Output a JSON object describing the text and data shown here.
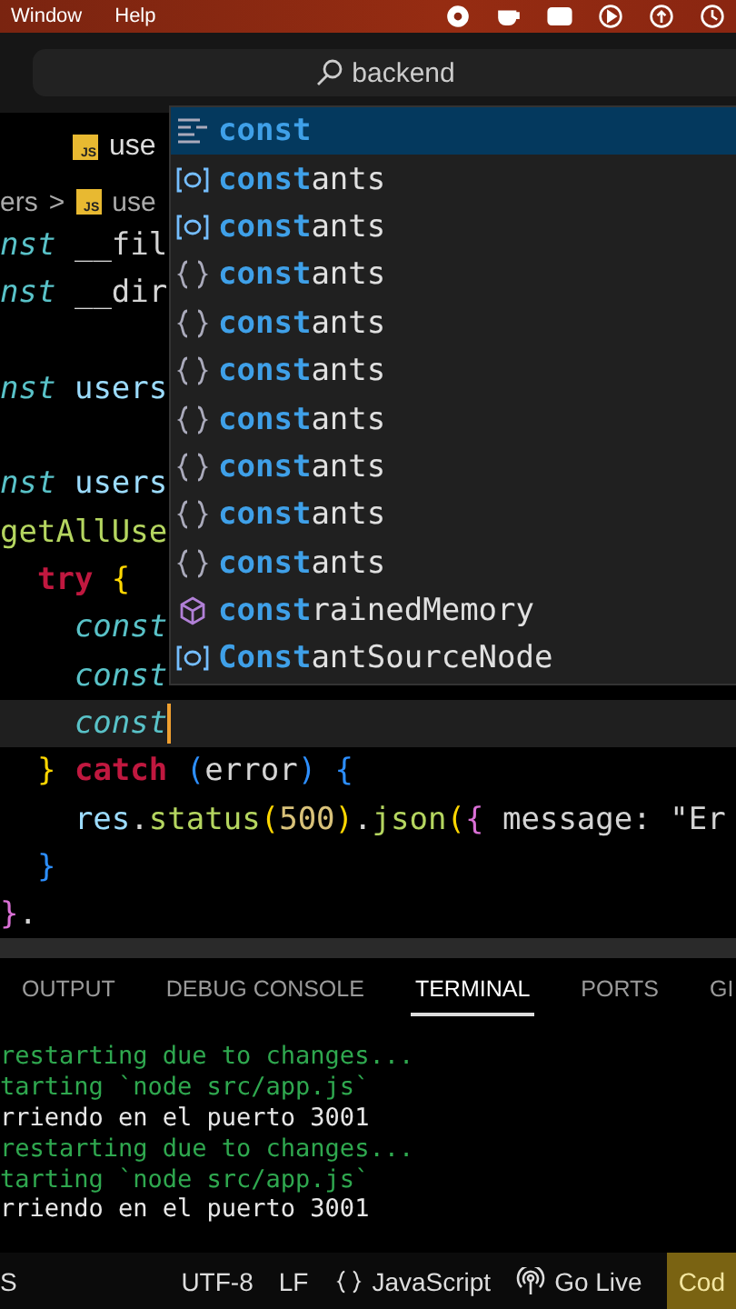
{
  "menubar": {
    "items": [
      "Window",
      "Help"
    ]
  },
  "command_center": {
    "text": "backend"
  },
  "editor_tab": {
    "badge": "JS",
    "label": "use",
    "selected": true
  },
  "breadcrumb": [
    {
      "kind": "text",
      "text": "ers"
    },
    {
      "kind": "separator",
      "text": ">"
    },
    {
      "kind": "file",
      "badge": "JS",
      "text": "use"
    }
  ],
  "code_lines": [
    {
      "current": false,
      "segments": [
        {
          "kind": "keyword",
          "text": "nst"
        },
        {
          "kind": "plain",
          "text": " __fil"
        }
      ]
    },
    {
      "current": false,
      "segments": [
        {
          "kind": "keyword",
          "text": "nst"
        },
        {
          "kind": "plain",
          "text": " __dir"
        }
      ]
    },
    {
      "current": false
    },
    {
      "current": false,
      "segments": [
        {
          "kind": "keyword",
          "text": "nst"
        },
        {
          "kind": "variable",
          "text": " users"
        }
      ]
    },
    {
      "current": false
    },
    {
      "current": false,
      "segments": [
        {
          "kind": "keyword",
          "text": "nst"
        },
        {
          "kind": "variable",
          "text": " users"
        }
      ]
    },
    {
      "current": false,
      "segments": [
        {
          "kind": "function",
          "text": "getAllUse"
        }
      ]
    },
    {
      "current": false,
      "segments": [
        {
          "kind": "control",
          "text": "  try"
        },
        {
          "kind": "bracket1",
          "text": " {"
        }
      ]
    },
    {
      "current": false,
      "segments": [
        {
          "kind": "keyword",
          "text": "    const"
        }
      ]
    },
    {
      "current": false,
      "segments": [
        {
          "kind": "keyword",
          "text": "    const"
        }
      ]
    },
    {
      "current": true,
      "segments": [
        {
          "kind": "keyword",
          "text": "    const"
        }
      ]
    },
    {
      "current": false,
      "segments": [
        {
          "kind": "bracket1",
          "text": "  }"
        },
        {
          "kind": "control",
          "text": " catch"
        },
        {
          "kind": "bracket2",
          "text": " ("
        },
        {
          "kind": "plain",
          "text": "error"
        },
        {
          "kind": "bracket2",
          "text": ")"
        },
        {
          "kind": "bracket2",
          "text": " {"
        }
      ]
    },
    {
      "current": false,
      "segments": [
        {
          "kind": "variable",
          "text": "    res"
        },
        {
          "kind": "plain",
          "text": "."
        },
        {
          "kind": "function",
          "text": "status"
        },
        {
          "kind": "bracket1",
          "text": "("
        },
        {
          "kind": "number",
          "text": "500"
        },
        {
          "kind": "bracket1",
          "text": ")"
        },
        {
          "kind": "plain",
          "text": "."
        },
        {
          "kind": "function",
          "text": "json"
        },
        {
          "kind": "bracket1",
          "text": "("
        },
        {
          "kind": "bracket3",
          "text": "{"
        },
        {
          "kind": "plain",
          "text": " message: \"Er"
        }
      ]
    },
    {
      "current": false,
      "segments": [
        {
          "kind": "bracket2",
          "text": "  }"
        }
      ]
    },
    {
      "current": false,
      "segments": [
        {
          "kind": "bracket3",
          "text": "}"
        },
        {
          "kind": "plain",
          "text": "."
        }
      ]
    }
  ],
  "suggestions": [
    {
      "kind": "snippet",
      "match": "const",
      "selected": true
    },
    {
      "kind": "variable",
      "match": "const",
      "rest": "ants",
      "selected": false
    },
    {
      "kind": "variable",
      "match": "const",
      "rest": "ants",
      "selected": false
    },
    {
      "kind": "module",
      "match": "const",
      "rest": "ants",
      "selected": false
    },
    {
      "kind": "module",
      "match": "const",
      "rest": "ants",
      "selected": false
    },
    {
      "kind": "module",
      "match": "const",
      "rest": "ants",
      "selected": false
    },
    {
      "kind": "module",
      "match": "const",
      "rest": "ants",
      "selected": false
    },
    {
      "kind": "module",
      "match": "const",
      "rest": "ants",
      "selected": false
    },
    {
      "kind": "module",
      "match": "const",
      "rest": "ants",
      "selected": false
    },
    {
      "kind": "module",
      "match": "const",
      "rest": "ants",
      "selected": false
    },
    {
      "kind": "property",
      "match": "const",
      "rest": "rainedMemory",
      "selected": false
    },
    {
      "kind": "variable",
      "match": "Const",
      "rest": "antSourceNode",
      "selected": false
    }
  ],
  "panel_tabs": [
    {
      "label": "OUTPUT",
      "selected": false
    },
    {
      "label": "DEBUG CONSOLE",
      "selected": false
    },
    {
      "label": "TERMINAL",
      "selected": true
    },
    {
      "label": "PORTS",
      "selected": false
    },
    {
      "label": "GI",
      "selected": false
    }
  ],
  "terminal_lines": [
    {
      "kind": "nodemon",
      "text": "restarting due to changes..."
    },
    {
      "kind": "nodemon",
      "text": "tarting `node src/app.js`"
    },
    {
      "kind": "log",
      "text": "rriendo en el puerto 3001"
    },
    {
      "kind": "nodemon",
      "text": "restarting due to changes..."
    },
    {
      "kind": "nodemon",
      "text": "tarting `node src/app.js`"
    },
    {
      "kind": "log",
      "text": "rriendo en el puerto 3001"
    }
  ],
  "status_bar": [
    {
      "kind": "text",
      "label": "S",
      "highlighted": false
    },
    {
      "kind": "spacer"
    },
    {
      "kind": "text",
      "label": "UTF-8",
      "highlighted": false
    },
    {
      "kind": "text",
      "label": "LF",
      "highlighted": false
    },
    {
      "kind": "language",
      "label": "JavaScript",
      "highlighted": false
    },
    {
      "kind": "golive",
      "label": "Go Live",
      "highlighted": false
    },
    {
      "kind": "text",
      "label": "Cod",
      "highlighted": true
    }
  ]
}
